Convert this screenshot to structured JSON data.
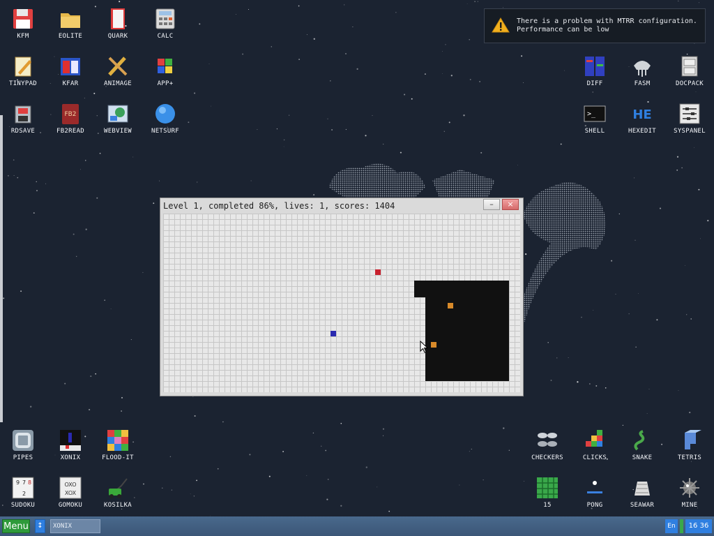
{
  "desktop": {
    "icons_left_top": [
      {
        "label": "KFM",
        "icon": "floppy-icon"
      },
      {
        "label": "EOLITE",
        "icon": "folder-icon"
      },
      {
        "label": "QUARK",
        "icon": "book-icon"
      },
      {
        "label": "CALC",
        "icon": "calculator-icon"
      },
      {
        "label": "TINYPAD",
        "icon": "notepad-icon"
      },
      {
        "label": "KFAR",
        "icon": "archive-icon"
      },
      {
        "label": "ANIMAGE",
        "icon": "pencil-ruler-icon"
      },
      {
        "label": "APP+",
        "icon": "cube-icon"
      },
      {
        "label": "RDSAVE",
        "icon": "disk-save-icon"
      },
      {
        "label": "FB2READ",
        "icon": "fb2-book-icon"
      },
      {
        "label": "WEBVIEW",
        "icon": "web-picture-icon"
      },
      {
        "label": "NETSURF",
        "icon": "globe-icon"
      }
    ],
    "icons_right_top": [
      {
        "label": "DIFF",
        "icon": "diff-icon"
      },
      {
        "label": "FASM",
        "icon": "fasm-icon"
      },
      {
        "label": "DOCPACK",
        "icon": "cabinet-icon"
      },
      {
        "label": "SHELL",
        "icon": "terminal-icon"
      },
      {
        "label": "HEXEDIT",
        "icon": "hex-icon"
      },
      {
        "label": "SYSPANEL",
        "icon": "sliders-icon"
      }
    ],
    "icons_left_bottom": [
      {
        "label": "PIPES",
        "icon": "pipes-icon"
      },
      {
        "label": "XONIX",
        "icon": "xonix-icon"
      },
      {
        "label": "FLOOD-IT",
        "icon": "flood-icon"
      },
      {
        "label": "SUDOKU",
        "icon": "sudoku-icon"
      },
      {
        "label": "GOMOKU",
        "icon": "gomoku-icon"
      },
      {
        "label": "KOSILKA",
        "icon": "lawnmower-icon"
      }
    ],
    "icons_right_bottom": [
      {
        "label": "CHECKERS",
        "icon": "checkers-icon"
      },
      {
        "label": "CLICKS",
        "icon": "blocks-icon"
      },
      {
        "label": "SNAKE",
        "icon": "snake-icon"
      },
      {
        "label": "TETRIS",
        "icon": "tetris-icon"
      },
      {
        "label": "15",
        "icon": "fifteen-icon"
      },
      {
        "label": "PONG",
        "icon": "pong-icon"
      },
      {
        "label": "SEAWAR",
        "icon": "seawar-icon"
      },
      {
        "label": "MINE",
        "icon": "mine-icon"
      }
    ]
  },
  "notification": {
    "line1": "There is a problem with MTRR configuration.",
    "line2": "Performance can be low",
    "icon": "warning-icon",
    "accent": "#f2b01e"
  },
  "game_window": {
    "title": "Level 1, completed 86%, lives: 1, scores: 1404",
    "minimize_label": "–",
    "close_label": "×",
    "level": 1,
    "completed_percent": 86,
    "lives": 1,
    "scores": 1404,
    "colors": {
      "grid_cell": "#e8e8e8",
      "captured": "#111111",
      "enemy": "#c8202e",
      "player": "#2a2ab0",
      "chaser": "#d88a2a"
    }
  },
  "taskbar": {
    "menu_label": "Menu",
    "switch_label": "↕",
    "task_label": "XONIX",
    "lang": "En",
    "clock": "16 36"
  }
}
